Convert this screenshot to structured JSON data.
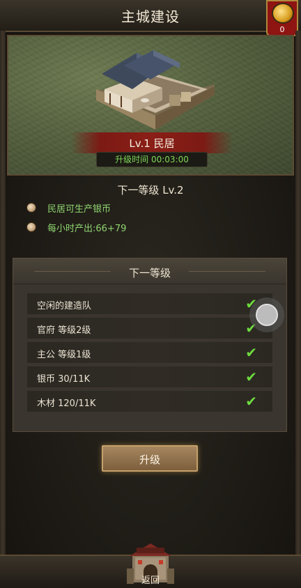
{
  "header": {
    "title": "主城建设",
    "gold_count": "0"
  },
  "building": {
    "level_label": "Lv.1 民居",
    "upgrade_time": "升级时间 00:03:00"
  },
  "next_level": {
    "title": "下一等级 Lv.2",
    "benefits": [
      "民居可生产银币",
      "每小时产出:66+79"
    ]
  },
  "requirements": {
    "title": "下一等级",
    "items": [
      {
        "label": "空闲的建造队",
        "met": true
      },
      {
        "label": "官府 等级2级",
        "met": true
      },
      {
        "label": "主公 等级1级",
        "met": true
      },
      {
        "label": "银币 30/11K",
        "met": true
      },
      {
        "label": "木材 120/11K",
        "met": true
      }
    ]
  },
  "actions": {
    "upgrade_label": "升级",
    "back_label": "返回"
  },
  "colors": {
    "benefit_text": "#8fd56f",
    "check": "#6ddb3e",
    "ribbon": "#8a1f17",
    "timer_text": "#7ed957"
  },
  "icons": [
    "gold-ingot-icon",
    "check-icon",
    "bullet-dot-icon",
    "city-gate-icon",
    "assistive-touch-icon"
  ]
}
